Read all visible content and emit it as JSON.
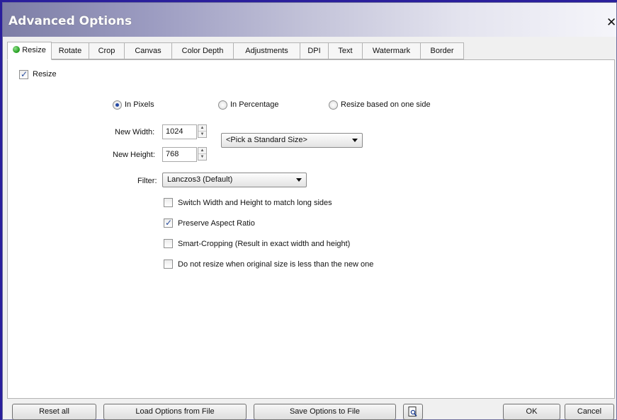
{
  "window": {
    "title": "Advanced Options",
    "close_glyph": "✕"
  },
  "tabs": [
    {
      "label": "Resize",
      "active": true
    },
    {
      "label": "Rotate"
    },
    {
      "label": "Crop"
    },
    {
      "label": "Canvas"
    },
    {
      "label": "Color Depth"
    },
    {
      "label": "Adjustments"
    },
    {
      "label": "DPI"
    },
    {
      "label": "Text"
    },
    {
      "label": "Watermark"
    },
    {
      "label": "Border"
    }
  ],
  "resize": {
    "enable_label": "Resize",
    "enable_checked": true,
    "modes": [
      {
        "label": "In Pixels",
        "selected": true
      },
      {
        "label": "In Percentage",
        "selected": false
      },
      {
        "label": "Resize based on one side",
        "selected": false
      }
    ],
    "width_label": "New Width:",
    "width_value": "1024",
    "height_label": "New Height:",
    "height_value": "768",
    "standard_size": "<Pick a Standard Size>",
    "filter_label": "Filter:",
    "filter_value": "Lanczos3 (Default)",
    "options": [
      {
        "label": "Switch Width and Height to match long sides",
        "checked": false
      },
      {
        "label": "Preserve Aspect Ratio",
        "checked": true
      },
      {
        "label": "Smart-Cropping (Result in exact width and height)",
        "checked": false
      },
      {
        "label": "Do not resize when original size is less than the new one",
        "checked": false
      }
    ]
  },
  "footer": {
    "reset": "Reset all",
    "load": "Load Options from File",
    "save": "Save Options to File",
    "preview_icon": "preview-icon",
    "ok": "OK",
    "cancel": "Cancel"
  },
  "colors": {
    "background": "#2a1f9c",
    "title_gradient_start": "#7d7ea6",
    "radio_dot": "#2347a3",
    "check_mark": "#2b4f9e",
    "active_dot": "#1e9a1a"
  }
}
